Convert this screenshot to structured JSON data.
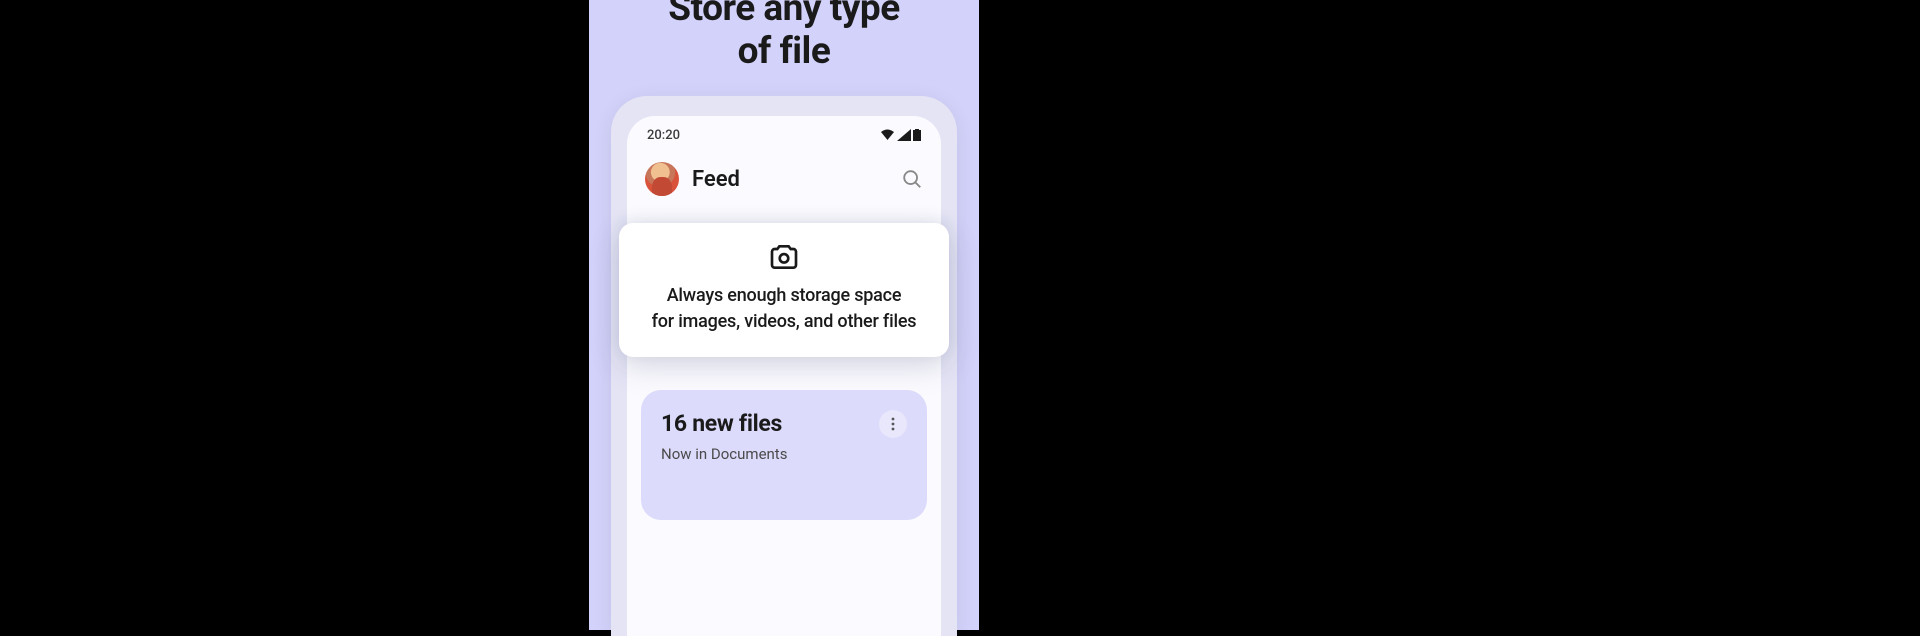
{
  "headline": {
    "line1": "Store any type",
    "line2": "of file"
  },
  "status_bar": {
    "time": "20:20"
  },
  "app_header": {
    "title": "Feed"
  },
  "promo_card": {
    "line1": "Always enough storage space",
    "line2": "for images, videos, and other files"
  },
  "feed_card": {
    "title": "16 new files",
    "subtitle": "Now in Documents"
  }
}
